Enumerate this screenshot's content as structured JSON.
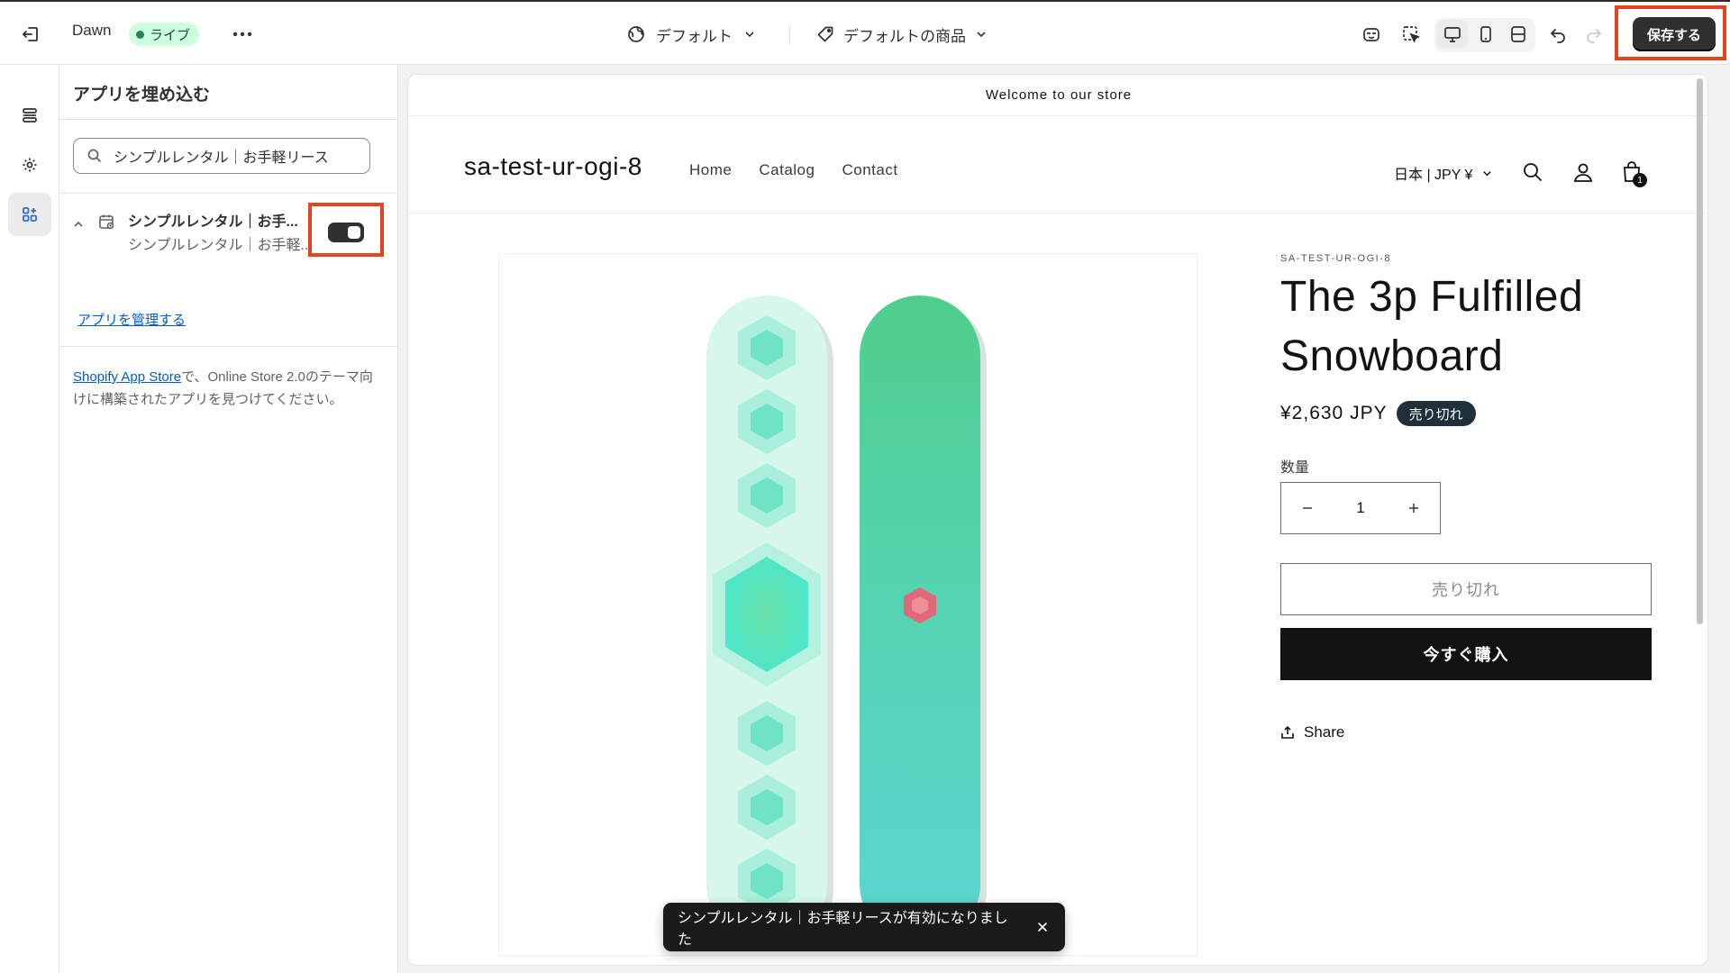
{
  "topbar": {
    "theme_name": "Dawn",
    "live_label": "ライブ",
    "template_label": "デフォルト",
    "product_label": "デフォルトの商品",
    "save_label": "保存する"
  },
  "panel": {
    "title": "アプリを埋め込む",
    "search_value": "シンプルレンタル｜お手軽リース",
    "app": {
      "name": "シンプルレンタル｜お手...",
      "subtitle": "シンプルレンタル｜お手軽...",
      "enabled": true
    },
    "manage_link": "アプリを管理する",
    "help_link": "Shopify App Store",
    "help_text": "で、Online Store 2.0のテーマ向けに構築されたアプリを見つけてください。"
  },
  "preview": {
    "announcement": "Welcome to our store",
    "logo": "sa-test-ur-ogi-8",
    "nav": [
      "Home",
      "Catalog",
      "Contact"
    ],
    "locale": "日本 | JPY ¥",
    "cart_count": "1",
    "product": {
      "vendor": "SA-TEST-UR-OGI-8",
      "title": "The 3p Fulfilled Snowboard",
      "price": "¥2,630 JPY",
      "sold_out_badge": "売り切れ",
      "quantity_label": "数量",
      "quantity_value": "1",
      "sold_out_button": "売り切れ",
      "buy_now_button": "今すぐ購入",
      "share_label": "Share"
    }
  },
  "toast": {
    "message": "シンプルレンタル｜お手軽リースが有効になりました"
  },
  "colors": {
    "accent_highlight": "#e8431f",
    "live_badge_bg": "#cdfee1",
    "live_badge_text": "#0c5132",
    "primary_button": "#303030",
    "link": "#005bd3",
    "board_left": "#d7f6ec",
    "board_right": "#4fd4b4"
  }
}
